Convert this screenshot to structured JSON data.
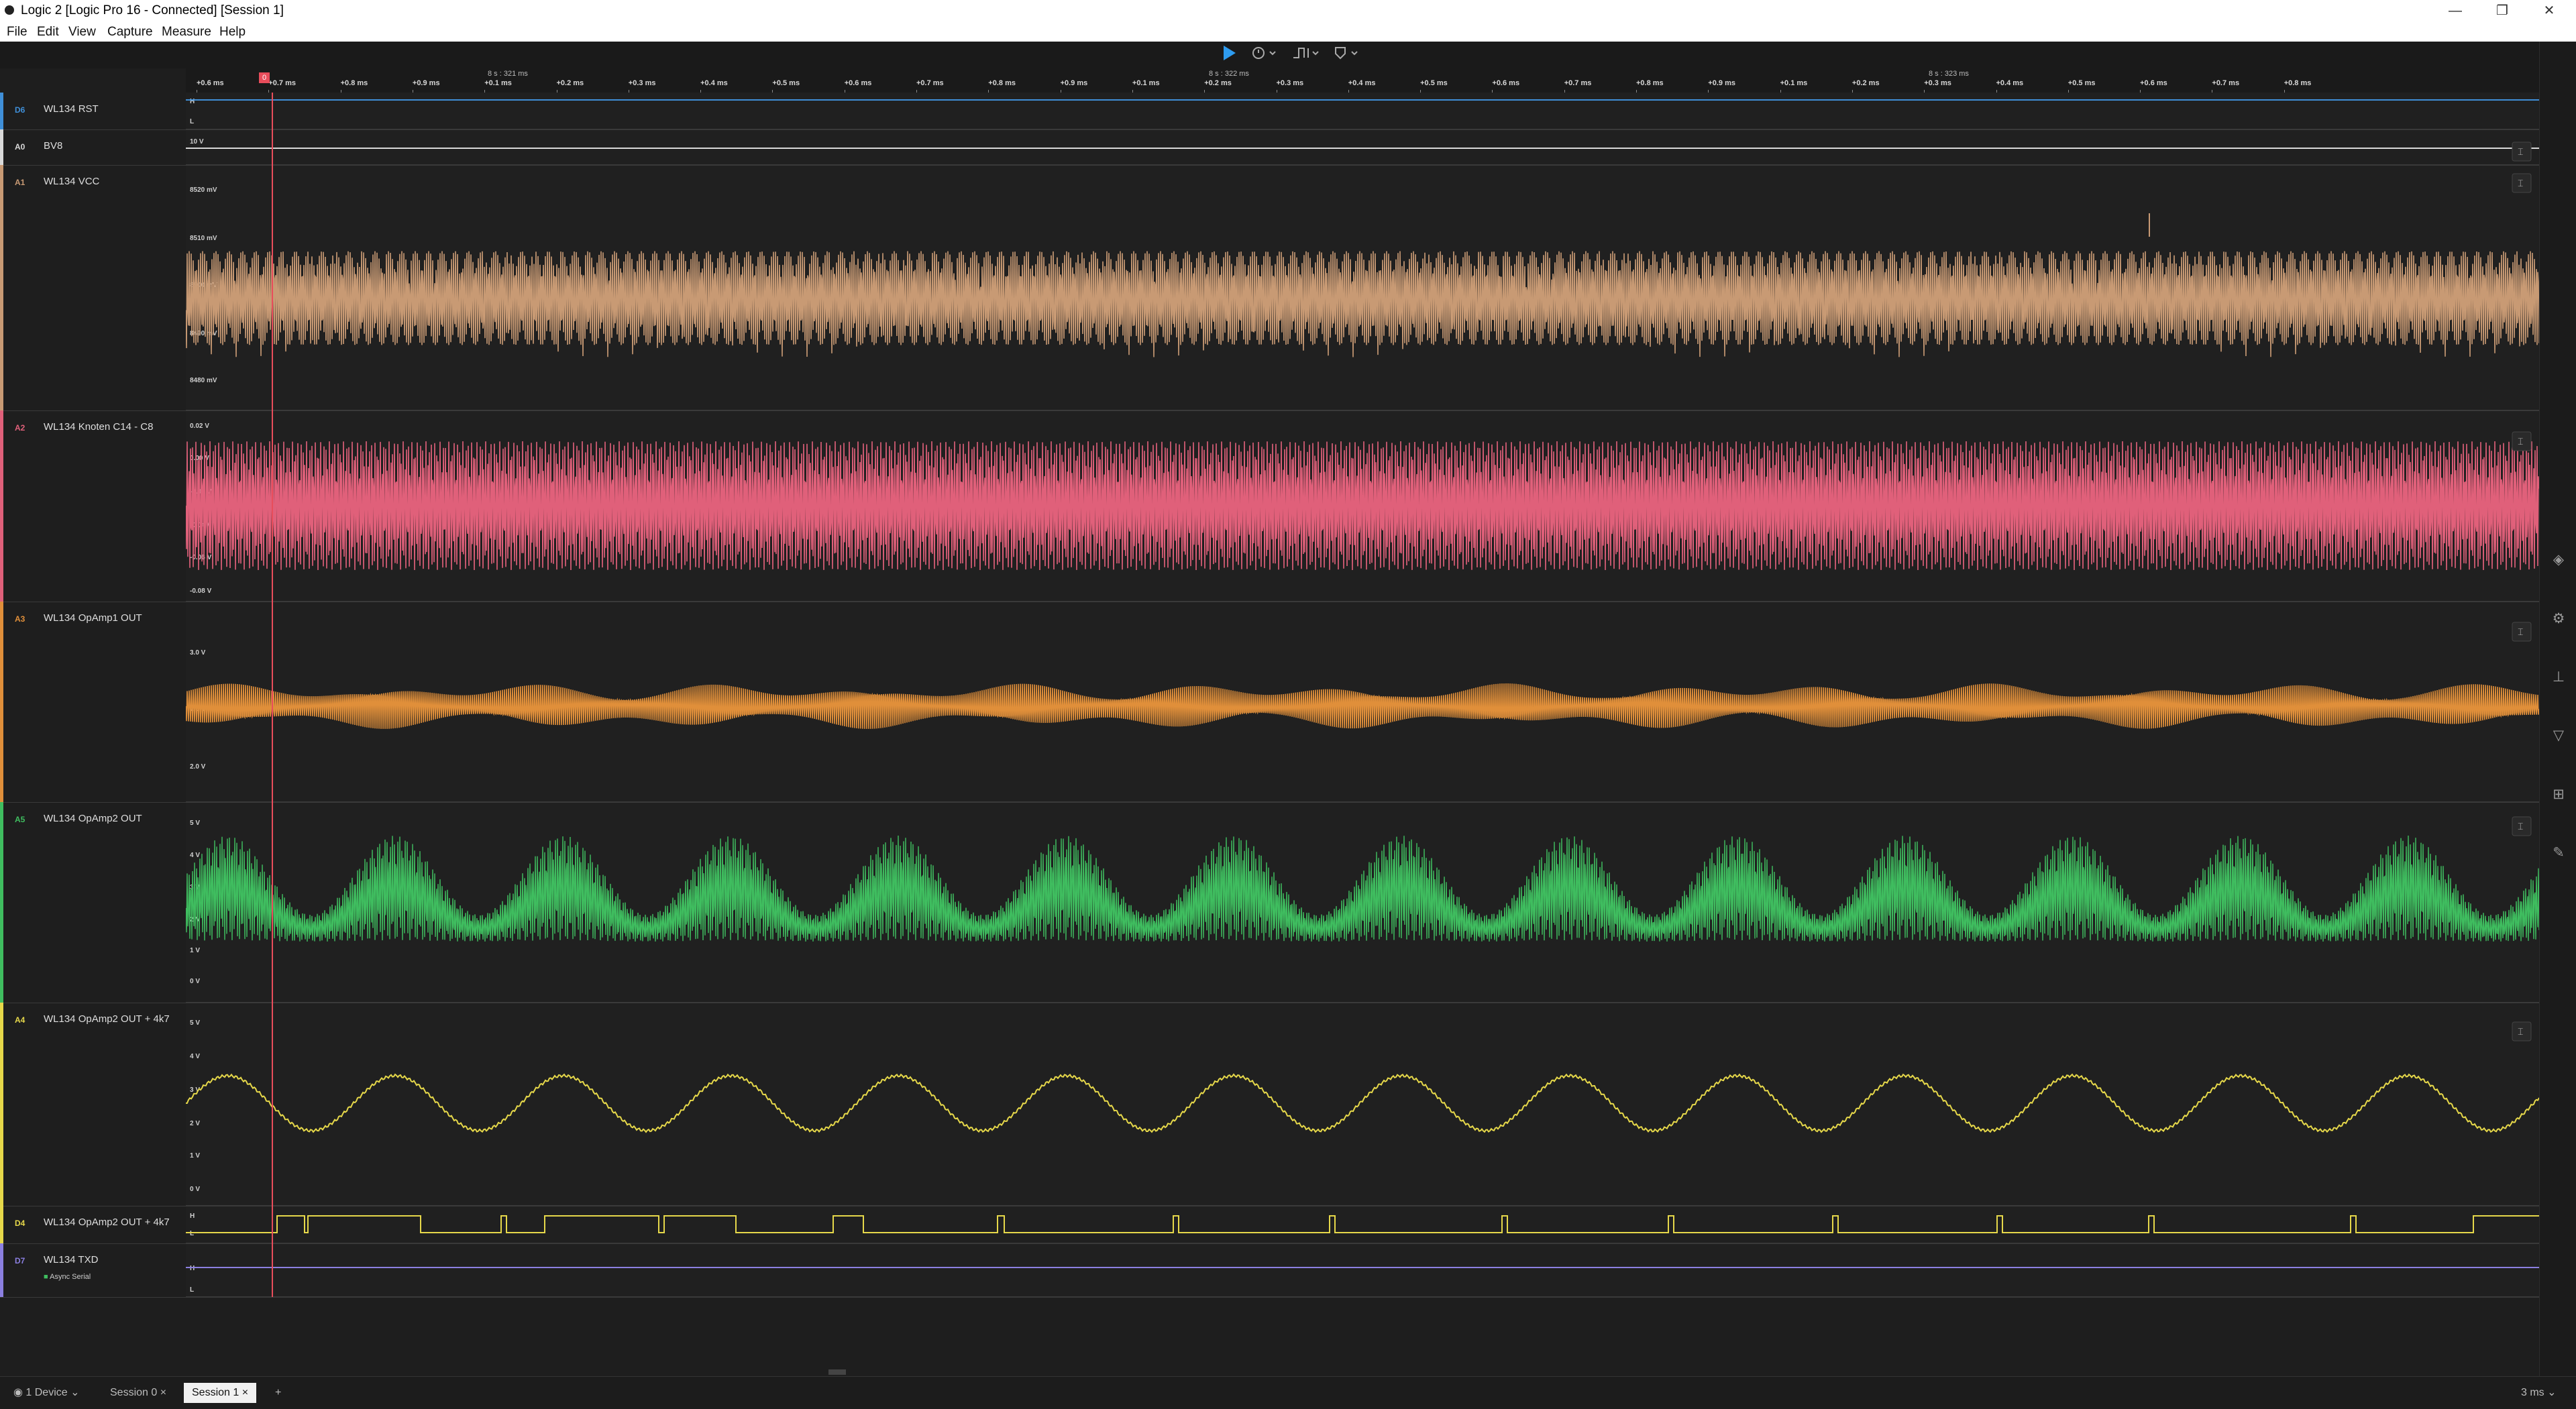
{
  "window": {
    "title": "Logic 2 [Logic Pro 16 - Connected] [Session 1]",
    "controls": {
      "minimize": "—",
      "restore": "❐",
      "close": "✕"
    }
  },
  "menu": [
    "File",
    "Edit",
    "View",
    "Capture",
    "Measure",
    "Help"
  ],
  "toolbar": {
    "play_icon": "play-icon",
    "buttons": [
      "timer-options",
      "trigger-options",
      "marker-options"
    ]
  },
  "timeline": {
    "seconds_markers": [
      "8 s : 321 ms",
      "8 s : 322 ms",
      "8 s : 323 ms"
    ],
    "ticks": [
      "+0.6 ms",
      "+0.7 ms",
      "+0.8 ms",
      "+0.9 ms",
      "+0.1 ms",
      "+0.2 ms",
      "+0.3 ms",
      "+0.4 ms",
      "+0.5 ms",
      "+0.6 ms",
      "+0.7 ms",
      "+0.8 ms",
      "+0.9 ms",
      "+0.1 ms",
      "+0.2 ms",
      "+0.3 ms",
      "+0.4 ms",
      "+0.5 ms",
      "+0.6 ms",
      "+0.7 ms",
      "+0.8 ms",
      "+0.9 ms",
      "+0.1 ms",
      "+0.2 ms",
      "+0.3 ms",
      "+0.4 ms",
      "+0.5 ms",
      "+0.6 ms",
      "+0.7 ms",
      "+0.8 ms"
    ],
    "timing_marker_label": "0",
    "timing_marker_color": "#e84d5b"
  },
  "channels": [
    {
      "id": "D6",
      "name": "WL134 RST",
      "kind": "digital",
      "color": "#3f8fd8",
      "scale": [
        "H",
        "L"
      ]
    },
    {
      "id": "A0",
      "name": "BV8",
      "kind": "analog-flat",
      "color": "#d9d9d9",
      "scale": [
        "10 V"
      ]
    },
    {
      "id": "A1",
      "name": "WL134 VCC",
      "kind": "analog",
      "color": "#c89a74",
      "scale": [
        "8520 mV",
        "8510 mV",
        "8500 mV",
        "8490 mV",
        "8480 mV"
      ]
    },
    {
      "id": "A2",
      "name": "WL134 Knoten C14 - C8",
      "kind": "analog",
      "color": "#e0607a",
      "scale": [
        "0.02 V",
        "0.00 V",
        "-0.02 V",
        "-0.04 V",
        "-0.06 V",
        "-0.08 V"
      ]
    },
    {
      "id": "A3",
      "name": "WL134 OpAmp1 OUT",
      "kind": "analog",
      "color": "#e08f3a",
      "scale": [
        "3.0 V",
        "2.5 V",
        "2.0 V"
      ]
    },
    {
      "id": "A5",
      "name": "WL134 OpAmp2 OUT",
      "kind": "analog",
      "color": "#3fbd5f",
      "scale": [
        "5 V",
        "4 V",
        "3 V",
        "2 V",
        "1 V",
        "0 V"
      ]
    },
    {
      "id": "A4",
      "name": "WL134 OpAmp2 OUT + 4k7",
      "kind": "analog",
      "color": "#e6d84a",
      "scale": [
        "5 V",
        "4 V",
        "3 V",
        "2 V",
        "1 V",
        "0 V"
      ]
    },
    {
      "id": "D4",
      "name": "WL134 OpAmp2 OUT + 4k7",
      "kind": "digital",
      "color": "#e6d84a",
      "scale": [
        "H",
        "L"
      ]
    },
    {
      "id": "D7",
      "name": "WL134 TXD",
      "kind": "digital",
      "color": "#8b7fe0",
      "scale": [
        "H",
        "L"
      ],
      "analyzer": "Async Serial"
    }
  ],
  "right_sidebar_icons": [
    "layers-icon",
    "settings-icon",
    "analyzers-icon",
    "markers-icon",
    "extensions-icon",
    "notes-icon"
  ],
  "bottom": {
    "device": "1 Device",
    "tabs": [
      {
        "label": "Session 0",
        "active": false
      },
      {
        "label": "Session 1",
        "active": true
      }
    ],
    "add_tab": "+",
    "zoom": "3 ms"
  }
}
